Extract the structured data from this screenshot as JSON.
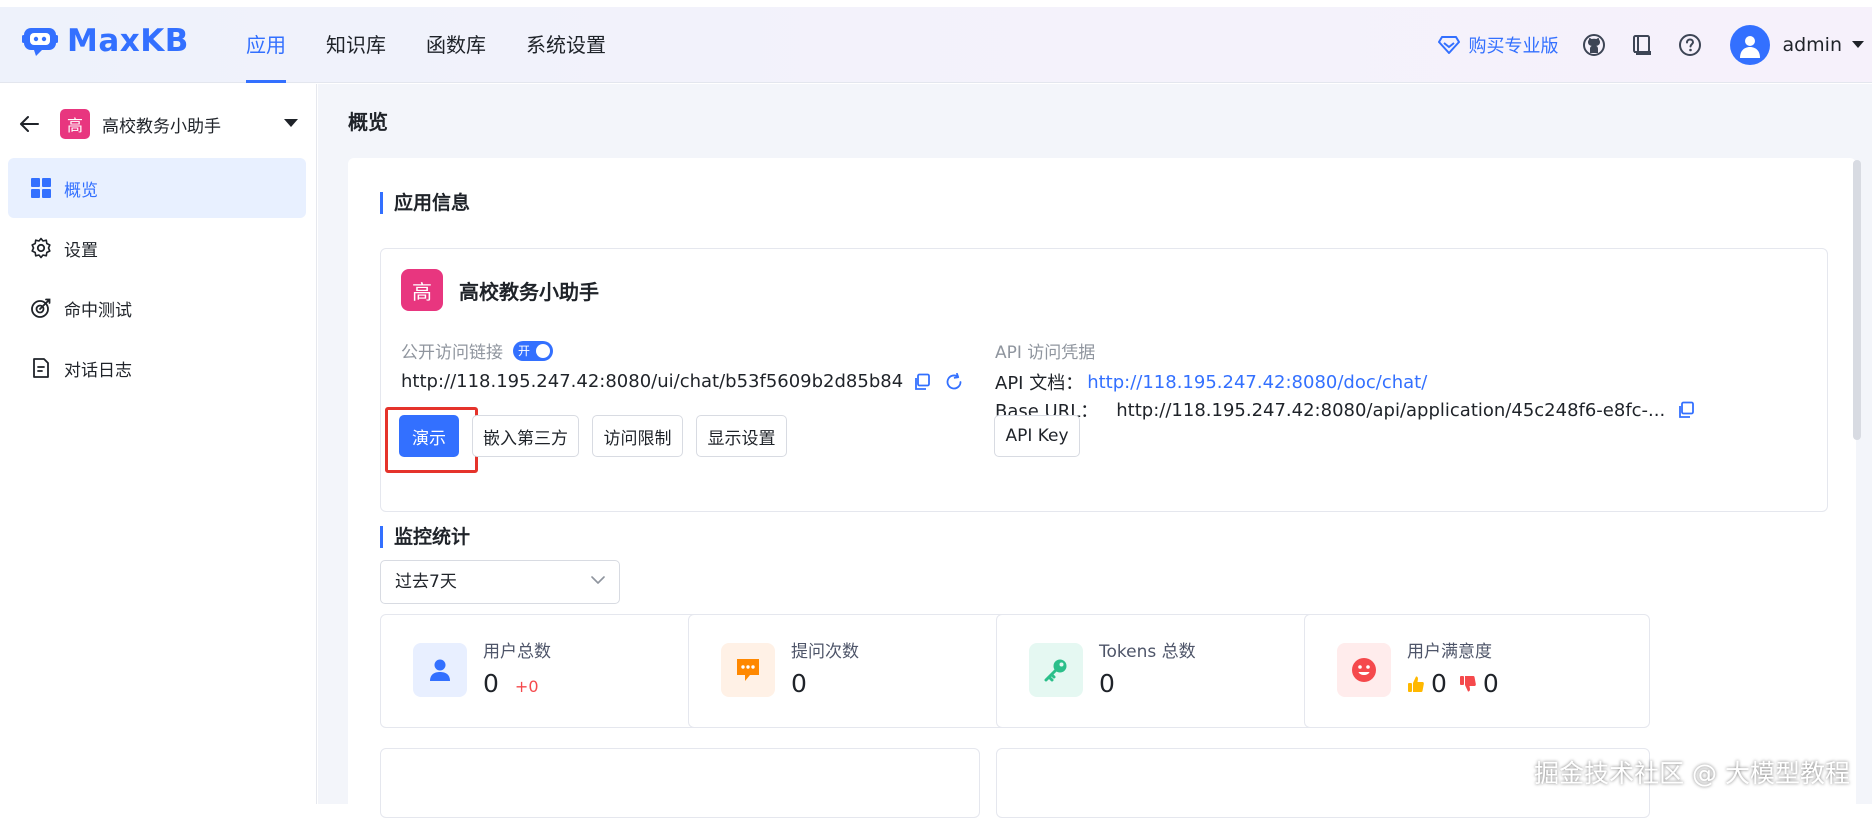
{
  "header": {
    "brand": "MaxKB",
    "nav": [
      {
        "label": "应用",
        "active": true
      },
      {
        "label": "知识库",
        "active": false
      },
      {
        "label": "函数库",
        "active": false
      },
      {
        "label": "系统设置",
        "active": false
      }
    ],
    "buy_pro": "购买专业版",
    "icons": [
      "github-icon",
      "book-icon",
      "help-icon"
    ],
    "username": "admin"
  },
  "sidebar": {
    "app_avatar": "高",
    "app_name": "高校教务小助手",
    "items": [
      {
        "label": "概览",
        "icon": "grid-icon",
        "active": true
      },
      {
        "label": "设置",
        "icon": "gear-icon",
        "active": false
      },
      {
        "label": "命中测试",
        "icon": "target-icon",
        "active": false
      },
      {
        "label": "对话日志",
        "icon": "document-icon",
        "active": false
      }
    ]
  },
  "main": {
    "page_title": "概览",
    "app_info": {
      "section_title": "应用信息",
      "avatar": "高",
      "name": "高校教务小助手",
      "public_link_label": "公开访问链接",
      "toggle_label": "开",
      "public_url": "http://118.195.247.42:8080/ui/chat/b53f5609b2d85b84",
      "api_credentials_label": "API 访问凭据",
      "api_doc_label": "API 文档：",
      "api_doc_url": "http://118.195.247.42:8080/doc/chat/",
      "base_url_label": "Base URL：",
      "base_url": "http://118.195.247.42:8080/api/application/45c248f6-e8fc-...",
      "buttons": {
        "demo": "演示",
        "embed": "嵌入第三方",
        "access": "访问限制",
        "display": "显示设置",
        "api_key": "API Key"
      }
    },
    "monitor": {
      "section_title": "监控统计",
      "range": "过去7天",
      "stats": [
        {
          "label": "用户总数",
          "value": "0",
          "delta": "+0"
        },
        {
          "label": "提问次数",
          "value": "0"
        },
        {
          "label": "Tokens 总数",
          "value": "0"
        },
        {
          "label": "用户满意度",
          "likes": "0",
          "dislikes": "0"
        }
      ]
    }
  },
  "colors": {
    "accent": "#3370ff",
    "app_avatar": "#e8367f",
    "highlight": "#e5332b",
    "delta": "#f5494c"
  },
  "watermark": "掘金技术社区 @ 大模型教程"
}
